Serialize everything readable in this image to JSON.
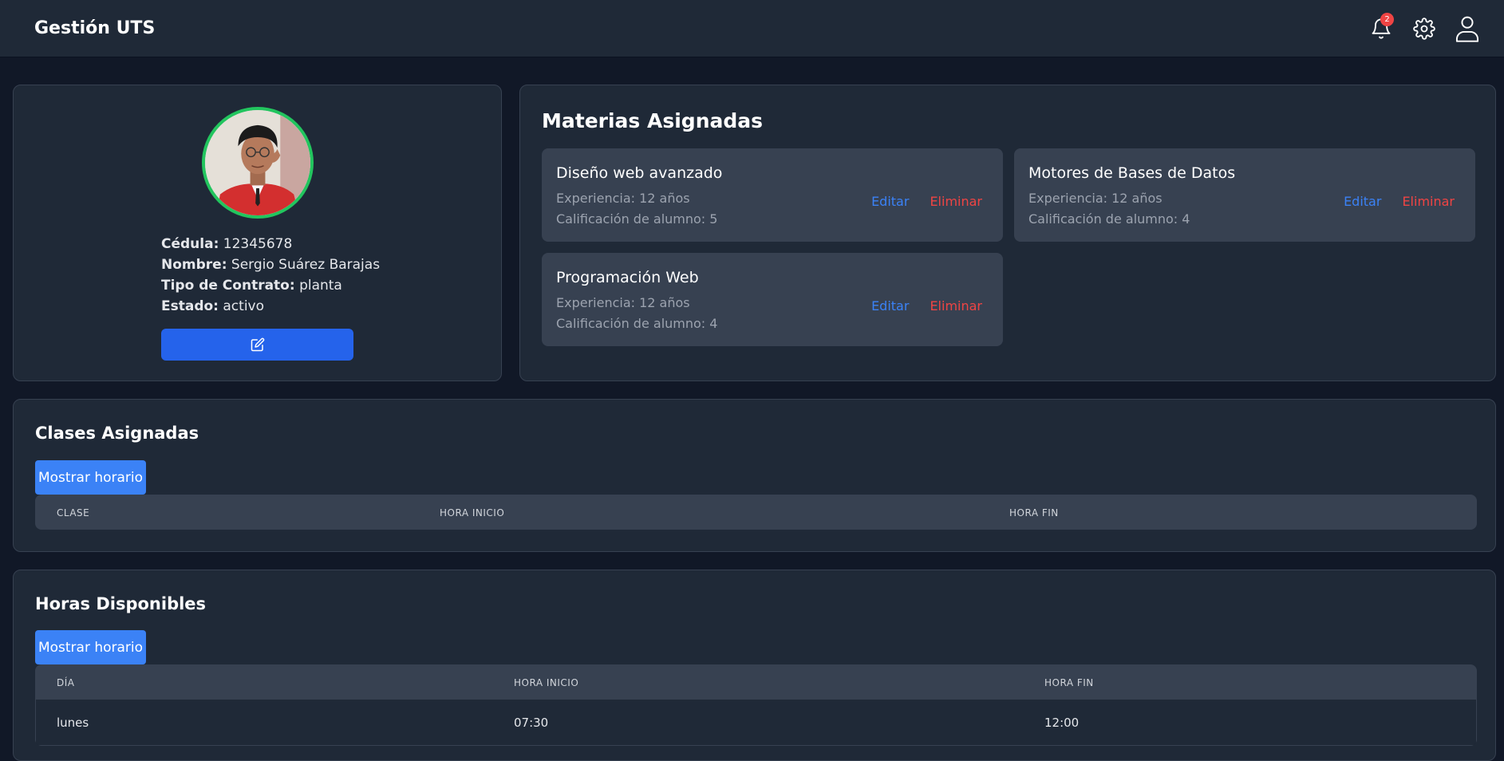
{
  "header": {
    "brand": "Gestión UTS",
    "notification_count": "2",
    "icons": [
      "bell-icon",
      "gear-icon",
      "user-icon"
    ]
  },
  "profile": {
    "cedula_label": "Cédula:",
    "cedula": "12345678",
    "nombre_label": "Nombre:",
    "nombre": "Sergio Suárez Barajas",
    "contrato_label": "Tipo de Contrato:",
    "contrato": "planta",
    "estado_label": "Estado:",
    "estado": "activo",
    "edit_icon": "pencil-square-icon"
  },
  "subjects": {
    "title": "Materias Asignadas",
    "edit_label": "Editar",
    "delete_label": "Eliminar",
    "items": [
      {
        "name": "Diseño web avanzado",
        "experience": "Experiencia: 12 años",
        "rating": "Calificación de alumno: 5"
      },
      {
        "name": "Motores de Bases de Datos",
        "experience": "Experiencia: 12 años",
        "rating": "Calificación de alumno: 4"
      },
      {
        "name": "Programación Web",
        "experience": "Experiencia: 12 años",
        "rating": "Calificación de alumno: 4"
      }
    ]
  },
  "classes": {
    "title": "Clases Asignadas",
    "button": "Mostrar horario",
    "columns": [
      "CLASE",
      "HORA INICIO",
      "HORA FIN"
    ]
  },
  "hours": {
    "title": "Horas Disponibles",
    "button": "Mostrar horario",
    "columns": [
      "DÍA",
      "HORA INICIO",
      "HORA FIN"
    ],
    "rows": [
      [
        "lunes",
        "07:30",
        "12:00"
      ]
    ]
  },
  "colors": {
    "background": "#111827",
    "card": "#1f2937",
    "accent": "#3b82f6",
    "danger": "#ef4444",
    "avatar_ring": "#22c55e"
  }
}
